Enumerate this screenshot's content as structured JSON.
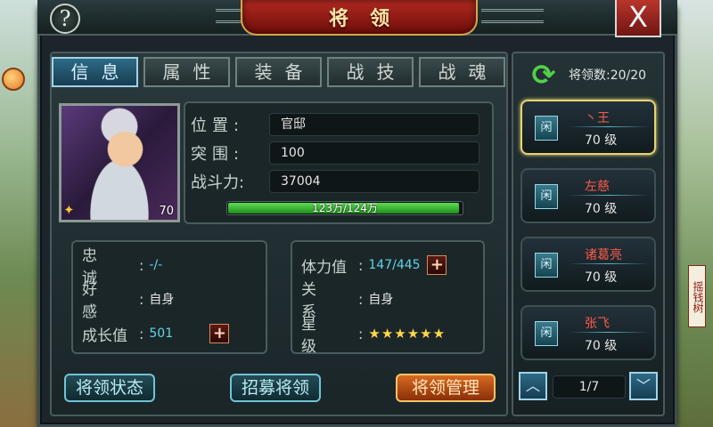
{
  "window": {
    "title": "将领",
    "help_label": "?",
    "close_label": "X"
  },
  "side_sign": "摇钱树",
  "tabs": [
    {
      "label": "信息",
      "active": true
    },
    {
      "label": "属性",
      "active": false
    },
    {
      "label": "装备",
      "active": false
    },
    {
      "label": "战技",
      "active": false
    },
    {
      "label": "战魂",
      "active": false
    }
  ],
  "portrait": {
    "level": "70"
  },
  "info": {
    "position_label": "位置:",
    "position_value": "官邸",
    "breakthrough_label": "突围:",
    "breakthrough_value": "100",
    "power_label": "战斗力:",
    "power_value": "37004",
    "exp_text": "123万/124万",
    "exp_fraction": 0.99
  },
  "stats": {
    "loyalty_label": "忠诚",
    "loyalty_value": "-/-",
    "favor_label": "好感",
    "favor_value": "自身",
    "growth_label": "成长值",
    "growth_value": "501",
    "stamina_label": "体力值",
    "stamina_value": "147/445",
    "relation_label": "关系",
    "relation_value": "自身",
    "star_label": "星级",
    "star_value": "★★★★★★",
    "star_count": 6,
    "plus": "+"
  },
  "buttons": {
    "status": "将领状态",
    "recruit": "招募将领",
    "manage": "将领管理"
  },
  "roster": {
    "count_label": "将领数:20/20",
    "cards": [
      {
        "badge": "闲",
        "name": "丶王",
        "level": "70 级",
        "selected": true
      },
      {
        "badge": "闲",
        "name": "左慈",
        "level": "70 级",
        "selected": false
      },
      {
        "badge": "闲",
        "name": "诸葛亮",
        "level": "70 级",
        "selected": false
      },
      {
        "badge": "闲",
        "name": "张飞",
        "level": "70 级",
        "selected": false
      }
    ],
    "page": "1/7"
  },
  "colors": {
    "accent": "#5fd4e8",
    "name_red": "#ff5a4a",
    "exp_green": "#3fbf36",
    "selected_border": "#e8d36a"
  }
}
